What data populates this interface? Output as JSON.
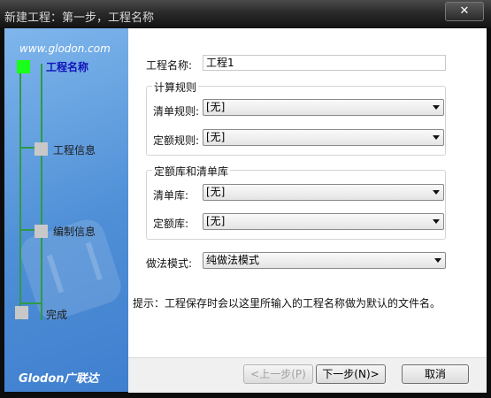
{
  "window": {
    "title": "新建工程：第一步，工程名称",
    "close_label": "✕"
  },
  "sidebar": {
    "site": "www.glodon.com",
    "steps": [
      {
        "label": "工程名称"
      },
      {
        "label": "工程信息"
      },
      {
        "label": "编制信息"
      },
      {
        "label": "完成"
      }
    ],
    "logo": "Glodon广联达"
  },
  "form": {
    "name_label": "工程名称:",
    "name_value": "工程1",
    "calc_rules": {
      "title": "计算规则",
      "qd_rule_label": "清单规则:",
      "qd_rule_value": "[无]",
      "de_rule_label": "定额规则:",
      "de_rule_value": "[无]"
    },
    "libs": {
      "title": "定额库和清单库",
      "qd_lib_label": "清单库:",
      "qd_lib_value": "[无]",
      "de_lib_label": "定额库:",
      "de_lib_value": "[无]"
    },
    "mode_label": "做法模式:",
    "mode_value": "纯做法模式",
    "hint": "提示：工程保存时会以这里所输入的工程名称做为默认的文件名。"
  },
  "buttons": {
    "prev": "<上一步(P)",
    "next": "下一步(N)>",
    "cancel": "取消"
  }
}
